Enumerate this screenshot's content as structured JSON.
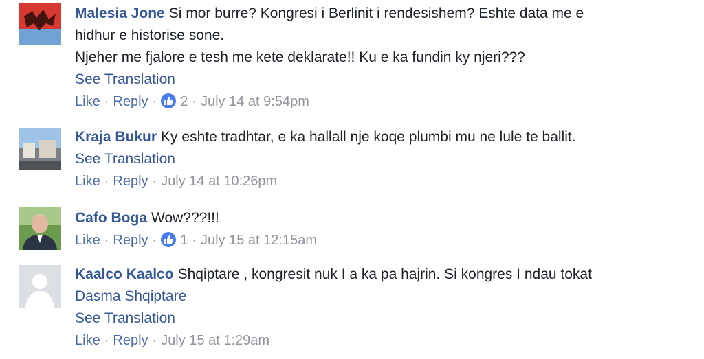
{
  "comments": [
    {
      "author": "Malesia Jone",
      "lines": [
        "Si mor burre? Kongresi i Berlinit i rendesishem? Eshte data me e",
        "hidhur e historise sone.",
        "Njeher me fjalore e tesh me kete deklarate!! Ku e ka fundin ky njeri???"
      ],
      "see_translation": "See Translation",
      "like": "Like",
      "reply": "Reply",
      "reactions": "2",
      "timestamp": "July 14 at 9:54pm"
    },
    {
      "author": "Kraja Bukur",
      "lines": [
        "Ky eshte tradhtar, e ka hallall nje koqe plumbi mu ne lule te ballit."
      ],
      "see_translation": "See Translation",
      "like": "Like",
      "reply": "Reply",
      "timestamp": "July 14 at 10:26pm"
    },
    {
      "author": "Cafo Boga",
      "lines": [
        "Wow???!!!"
      ],
      "like": "Like",
      "reply": "Reply",
      "reactions": "1",
      "timestamp": "July 15 at 12:15am"
    },
    {
      "author": "Kaalco Kaalco",
      "lines": [
        "Shqiptare , kongresit nuk I a ka pa hajrin. Si kongres I ndau tokat"
      ],
      "tag_link": "Dasma Shqiptare",
      "see_translation": "See Translation",
      "like": "Like",
      "reply": "Reply",
      "timestamp": "July 15 at 1:29am"
    }
  ],
  "separator": "·",
  "colors": {
    "link": "#365899",
    "meta": "#90949c",
    "like_badge": "#4b7bf0"
  },
  "icons": {
    "reaction": "thumbs-up-icon"
  }
}
